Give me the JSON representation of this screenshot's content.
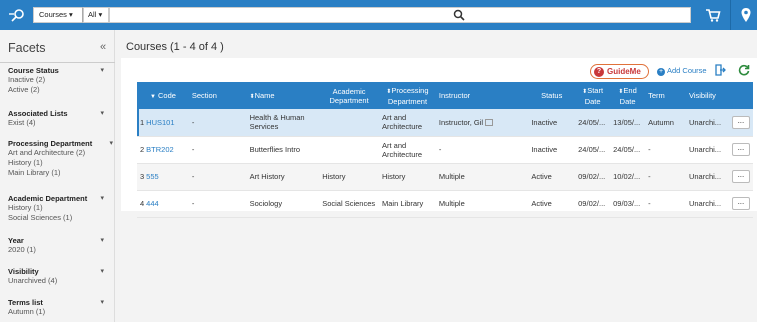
{
  "topbar": {
    "scope": "Courses",
    "scope2": "All",
    "search_value": "",
    "colors": {
      "bar": "#2a7fc4"
    }
  },
  "facets": {
    "title": "Facets",
    "collapse": "«",
    "groups": [
      {
        "name": "Course Status",
        "values": [
          "Inactive (2)",
          "Active (2)"
        ]
      },
      {
        "name": "Associated Lists",
        "values": [
          "Exist (4)"
        ]
      },
      {
        "name": "Processing Department",
        "values": [
          "Art and Architecture (2)",
          "History (1)",
          "Main Library (1)"
        ]
      },
      {
        "name": "Academic Department",
        "values": [
          "History (1)",
          "Social Sciences (1)"
        ]
      },
      {
        "name": "Year",
        "values": [
          "2020 (1)"
        ]
      },
      {
        "name": "Visibility",
        "values": [
          "Unarchived (4)"
        ]
      },
      {
        "name": "Terms list",
        "values": [
          "Autumn (1)"
        ]
      }
    ]
  },
  "main": {
    "title": "Courses (1 - 4 of 4 )",
    "guideme": "GuideMe",
    "add_course": "Add Course"
  },
  "table": {
    "columns": {
      "code": "Code",
      "section": "Section",
      "name": "Name",
      "acad1": "Academic",
      "acad2": "Department",
      "proc1": "Processing",
      "proc2": "Department",
      "instructor": "Instructor",
      "status": "Status",
      "start1": "Start",
      "start2": "Date",
      "end1": "End",
      "end2": "Date",
      "term": "Term",
      "visibility": "Visibility"
    },
    "rows": [
      {
        "num": "1",
        "code": "HUS101",
        "section": "-",
        "name": "Health & Human Services",
        "academic": "",
        "processing": "Art and Architecture",
        "instructor": "Instructor, Gil",
        "status": "Inactive",
        "start": "24/05/...",
        "end": "13/05/...",
        "term": "Autumn",
        "visibility": "Unarchi...",
        "menu": "..."
      },
      {
        "num": "2",
        "code": "BTR202",
        "section": "-",
        "name": "Butterflies Intro",
        "academic": "",
        "processing": "Art and Architecture",
        "instructor": "-",
        "status": "Inactive",
        "start": "24/05/...",
        "end": "24/05/...",
        "term": "-",
        "visibility": "Unarchi...",
        "menu": "..."
      },
      {
        "num": "3",
        "code": "555",
        "section": "-",
        "name": "Art History",
        "academic": "History",
        "processing": "History",
        "instructor": "Multiple",
        "status": "Active",
        "start": "09/02/...",
        "end": "10/02/...",
        "term": "-",
        "visibility": "Unarchi...",
        "menu": "..."
      },
      {
        "num": "4",
        "code": "444",
        "section": "-",
        "name": "Sociology",
        "academic": "Social Sciences",
        "processing": "Main Library",
        "instructor": "Multiple",
        "status": "Active",
        "start": "09/02/...",
        "end": "09/03/...",
        "term": "-",
        "visibility": "Unarchi...",
        "menu": "..."
      }
    ]
  }
}
